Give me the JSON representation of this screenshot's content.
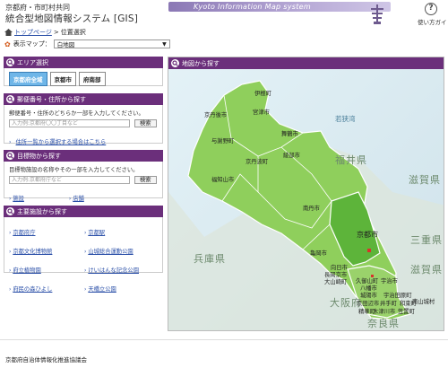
{
  "header": {
    "org_line": "京都府・市町村共同",
    "system_title": "統合型地図情報システム [GIS]",
    "banner_text": "Kyoto Information Map system",
    "help_label": "使い方ガイド"
  },
  "breadcrumb": {
    "top_link": "トップページ",
    "separator": ">",
    "current": "位置選択"
  },
  "display_map": {
    "label": "表示マップ：",
    "selected": "白地図"
  },
  "area_panel": {
    "title": "エリア選択",
    "buttons": [
      "京都府全域",
      "京都市",
      "府南部"
    ],
    "active_index": 0
  },
  "address_panel": {
    "title": "郵便番号・住所から探す",
    "hint": "郵便番号・住所のどちらか一部を入力してください。",
    "placeholder": "入力例:京都府〇〇丁目など",
    "search_label": "検索",
    "list_link": "住所一覧から選択する場合はこちら"
  },
  "landmark_panel": {
    "title": "目標物から探す",
    "hint": "目標物施設の名称やその一部を入力してください。",
    "placeholder": "入力例:京都府庁など",
    "search_label": "検索",
    "links": [
      "施設",
      "店舗"
    ]
  },
  "facility_panel": {
    "title": "主要施設から探す",
    "links": [
      "京都府庁",
      "京都駅",
      "京都文化博物館",
      "山城総合運動公園",
      "府立植物園",
      "けいはんな記念公園",
      "府民の森ひよし",
      "天橋立公園"
    ]
  },
  "map": {
    "title": "地図から探す",
    "sea_label": "若狭湾",
    "prefectures": [
      "福井県",
      "滋賀県",
      "兵庫県",
      "大阪府",
      "奈良県",
      "三重県",
      "滋賀県"
    ],
    "kyoto_city": "京都市",
    "municipalities": {
      "ine": "伊根町",
      "kyotango": "京丹後市",
      "miyazu": "宮津市",
      "yosano": "与謝野町",
      "maizuru": "舞鶴市",
      "fukuchiyama": "福知山市",
      "ayabe": "綾部市",
      "kyotamba": "京丹波町",
      "nantan": "南丹市",
      "kameoka": "亀岡市",
      "muko": "向日市",
      "nagaokakyo": "長岡京市",
      "oyamazaki": "大山崎町",
      "kumiyama": "久御山町",
      "yawata": "八幡市",
      "uji": "宇治市",
      "joyo": "城陽市",
      "ujitawara": "宇治田原町",
      "kyotanabe": "京田辺市",
      "ide": "井手町",
      "wazuka": "和束町",
      "seika": "精華町",
      "kizugawa": "木津川市",
      "kasagi": "笠置町",
      "minamiyamashiro": "南山城村"
    }
  },
  "footer": {
    "text": "京都府自治体情報化推進協議会"
  },
  "colors": {
    "accent": "#6b2f7b",
    "active_button": "#6fb6e8",
    "map_land": "#8fcf5c",
    "kyoto_city": "#5db43a",
    "link": "#2a4fa8"
  }
}
